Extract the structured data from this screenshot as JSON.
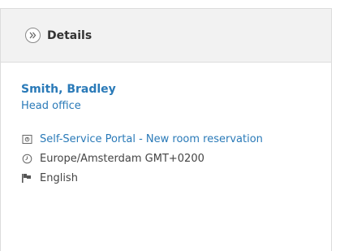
{
  "panel": {
    "title": "Details"
  },
  "person": {
    "name": "Smith, Bradley",
    "location": "Head office"
  },
  "info": {
    "source_link": "Self-Service Portal - New room reservation",
    "timezone": "Europe/Amsterdam GMT+0200",
    "language": "English"
  },
  "icons": {
    "collapse": "double-chevron-right-icon",
    "source": "portal-icon",
    "timezone": "clock-icon",
    "language": "flag-icon"
  },
  "colors": {
    "link": "#2a7ab8",
    "header_bg": "#f2f2f2"
  }
}
